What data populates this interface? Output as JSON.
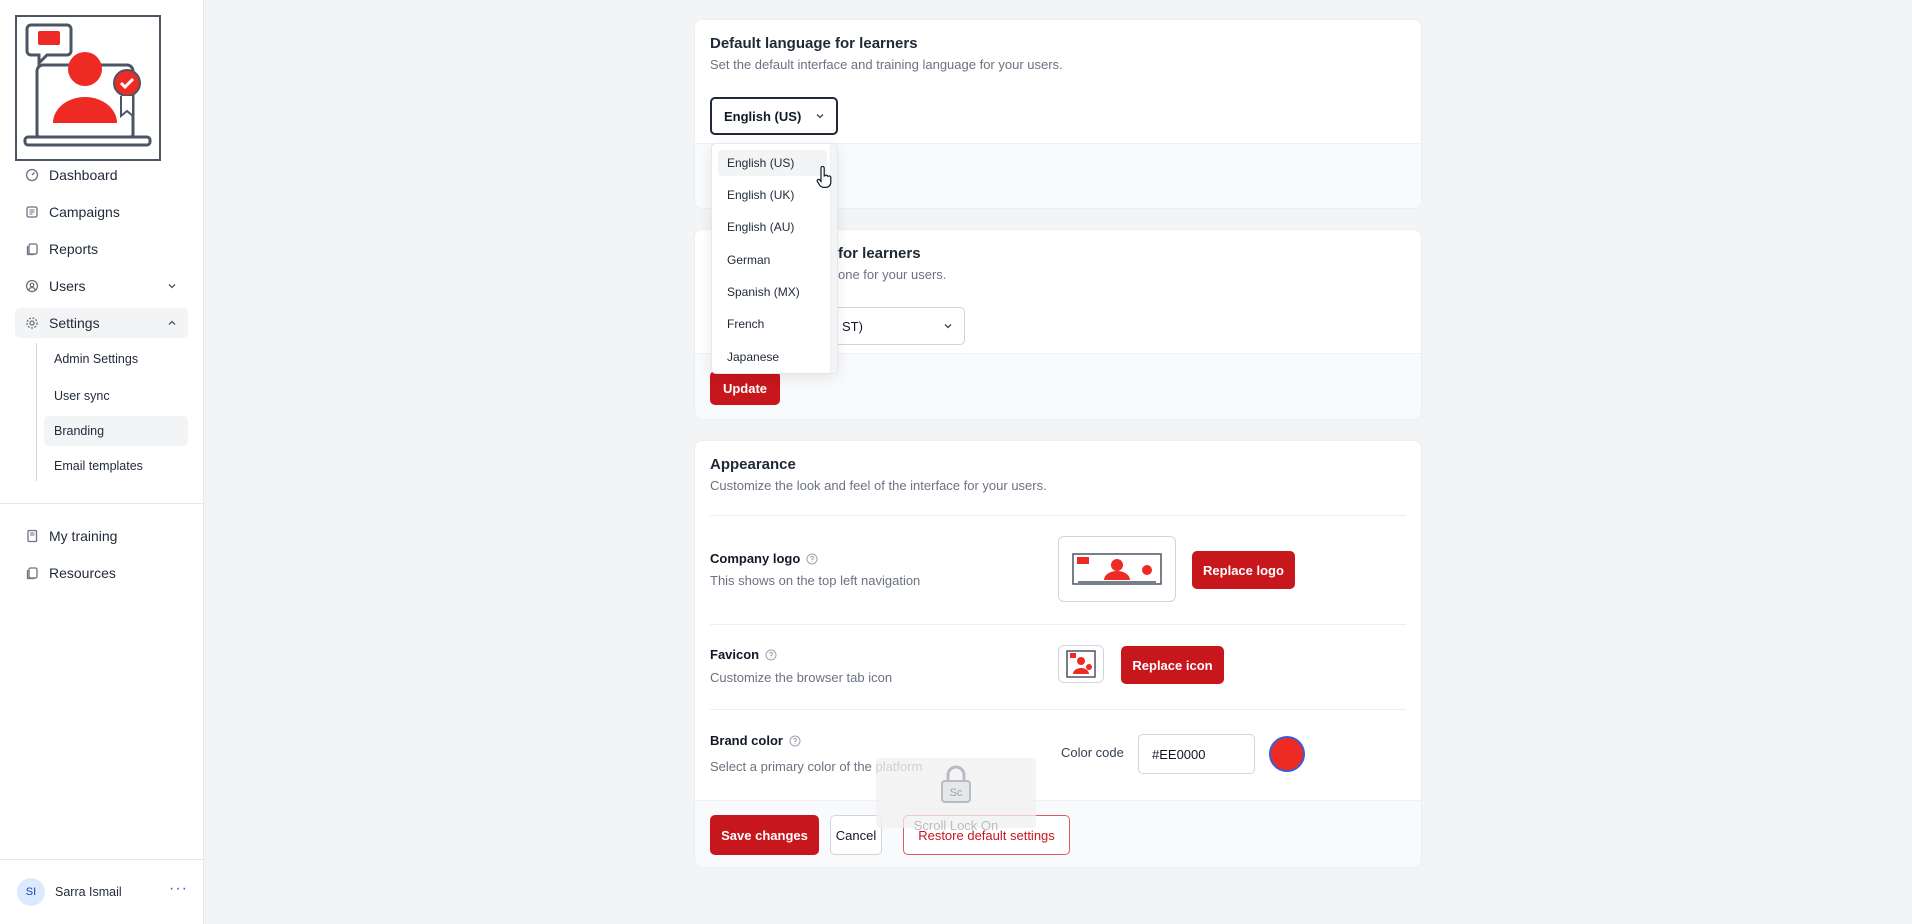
{
  "sidebar": {
    "items": [
      {
        "label": "Dashboard",
        "icon": "gauge-icon"
      },
      {
        "label": "Campaigns",
        "icon": "campaign-icon"
      },
      {
        "label": "Reports",
        "icon": "reports-icon"
      },
      {
        "label": "Users",
        "icon": "users-icon"
      },
      {
        "label": "Settings",
        "icon": "gear-icon"
      }
    ],
    "settings_sub": [
      "Admin Settings",
      "User sync",
      "Branding",
      "Email templates"
    ],
    "bottom_items": [
      {
        "label": "My training",
        "icon": "book-icon"
      },
      {
        "label": "Resources",
        "icon": "resources-icon"
      }
    ],
    "user": {
      "initials": "SI",
      "name": "Sarra Ismail",
      "more": "···"
    }
  },
  "language_card": {
    "title": "Default language for learners",
    "description": "Set the default interface and training language for your users.",
    "selected": "English (US)",
    "options": [
      "English (US)",
      "English (UK)",
      "English (AU)",
      "German",
      "Spanish (MX)",
      "French",
      "Japanese"
    ]
  },
  "timezone_card": {
    "title_visible": "for learners",
    "description_visible": "one for your users.",
    "selected_visible": "ST)",
    "update_label": "Update"
  },
  "appearance": {
    "title": "Appearance",
    "description": "Customize the look and feel of the interface for your users.",
    "logo": {
      "label": "Company logo",
      "description": "This shows on the top left navigation",
      "button": "Replace logo"
    },
    "favicon": {
      "label": "Favicon",
      "description": "Customize the browser tab icon",
      "button": "Replace icon"
    },
    "brand_color": {
      "label": "Brand color",
      "description": "Select a primary color of the platform",
      "code_label": "Color code",
      "value": "#EE0000",
      "swatch": "#ee2a24"
    }
  },
  "actions": {
    "save": "Save changes",
    "cancel": "Cancel",
    "restore": "Restore default settings"
  },
  "overlay": {
    "scroll_lock": "Scroll Lock On",
    "scroll_lock_key": "Sc"
  },
  "colors": {
    "brand": "#c8161d",
    "accent_blue": "#3b5bdb"
  }
}
